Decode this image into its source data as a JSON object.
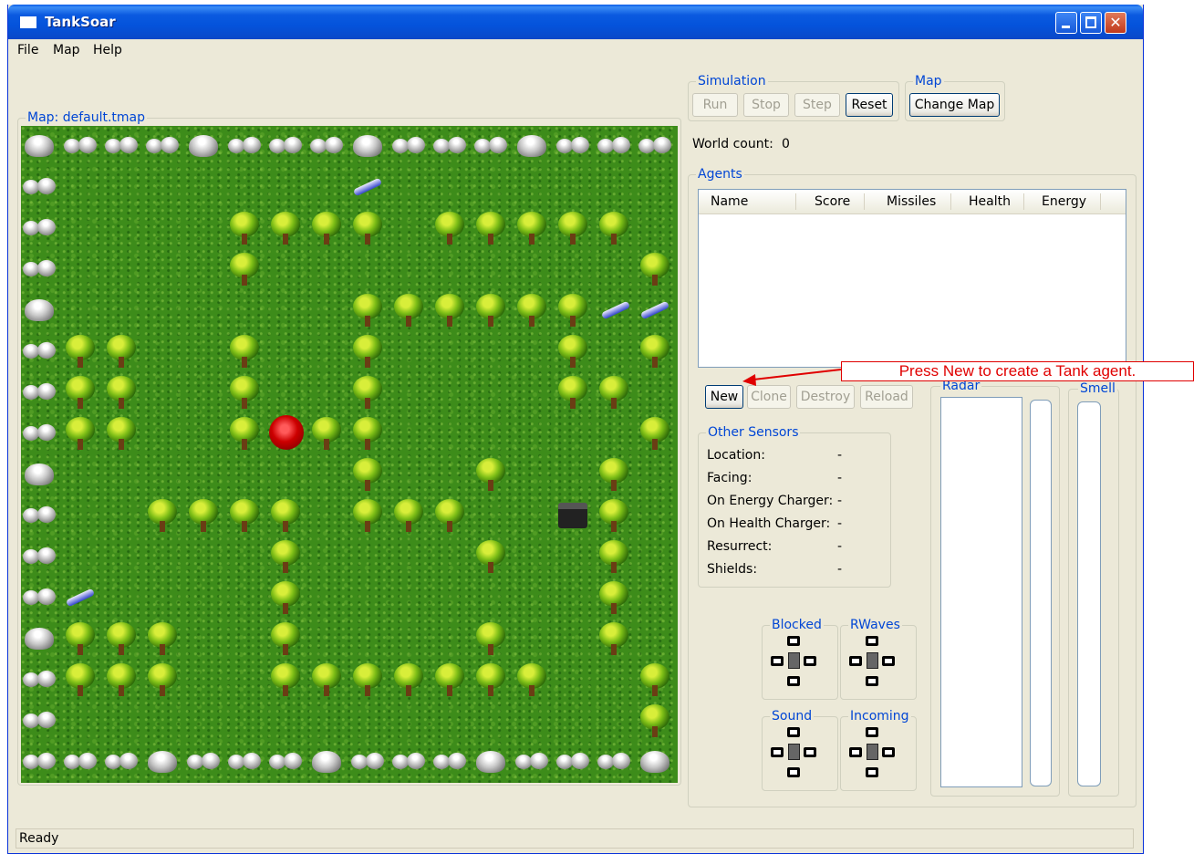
{
  "window": {
    "title": "TankSoar"
  },
  "menu": {
    "file": "File",
    "map": "Map",
    "help": "Help"
  },
  "map_panel": {
    "label": "Map: default.tmap"
  },
  "simulation": {
    "label": "Simulation",
    "run": "Run",
    "stop": "Stop",
    "step": "Step",
    "reset": "Reset"
  },
  "map_group": {
    "label": "Map",
    "change_map": "Change Map"
  },
  "world_count": {
    "label": "World count:",
    "value": "0"
  },
  "agents": {
    "label": "Agents",
    "columns": [
      "Name",
      "Score",
      "Missiles",
      "Health",
      "Energy"
    ],
    "buttons": {
      "new": "New",
      "clone": "Clone",
      "destroy": "Destroy",
      "reload": "Reload"
    }
  },
  "other_sensors": {
    "label": "Other Sensors",
    "rows": [
      {
        "name": "Location:",
        "value": "-"
      },
      {
        "name": "Facing:",
        "value": "-"
      },
      {
        "name": "On Energy Charger:",
        "value": "-"
      },
      {
        "name": "On Health Charger:",
        "value": "-"
      },
      {
        "name": "Resurrect:",
        "value": "-"
      },
      {
        "name": "Shields:",
        "value": "-"
      }
    ]
  },
  "sensor_panels": {
    "blocked": "Blocked",
    "rwaves": "RWaves",
    "sound": "Sound",
    "incoming": "Incoming"
  },
  "radar": {
    "label": "Radar"
  },
  "smell": {
    "label": "Smell"
  },
  "status": {
    "text": "Ready"
  },
  "annotation": {
    "text": "Press New to create a Tank agent.",
    "color": "#e00000"
  },
  "icons": [
    "app-window-icon",
    "minimize-icon",
    "maximize-icon",
    "close-icon",
    "tree-icon",
    "rock-icon",
    "missile-pack-icon",
    "health-charger-icon",
    "energy-charger-icon",
    "tank-icon"
  ]
}
